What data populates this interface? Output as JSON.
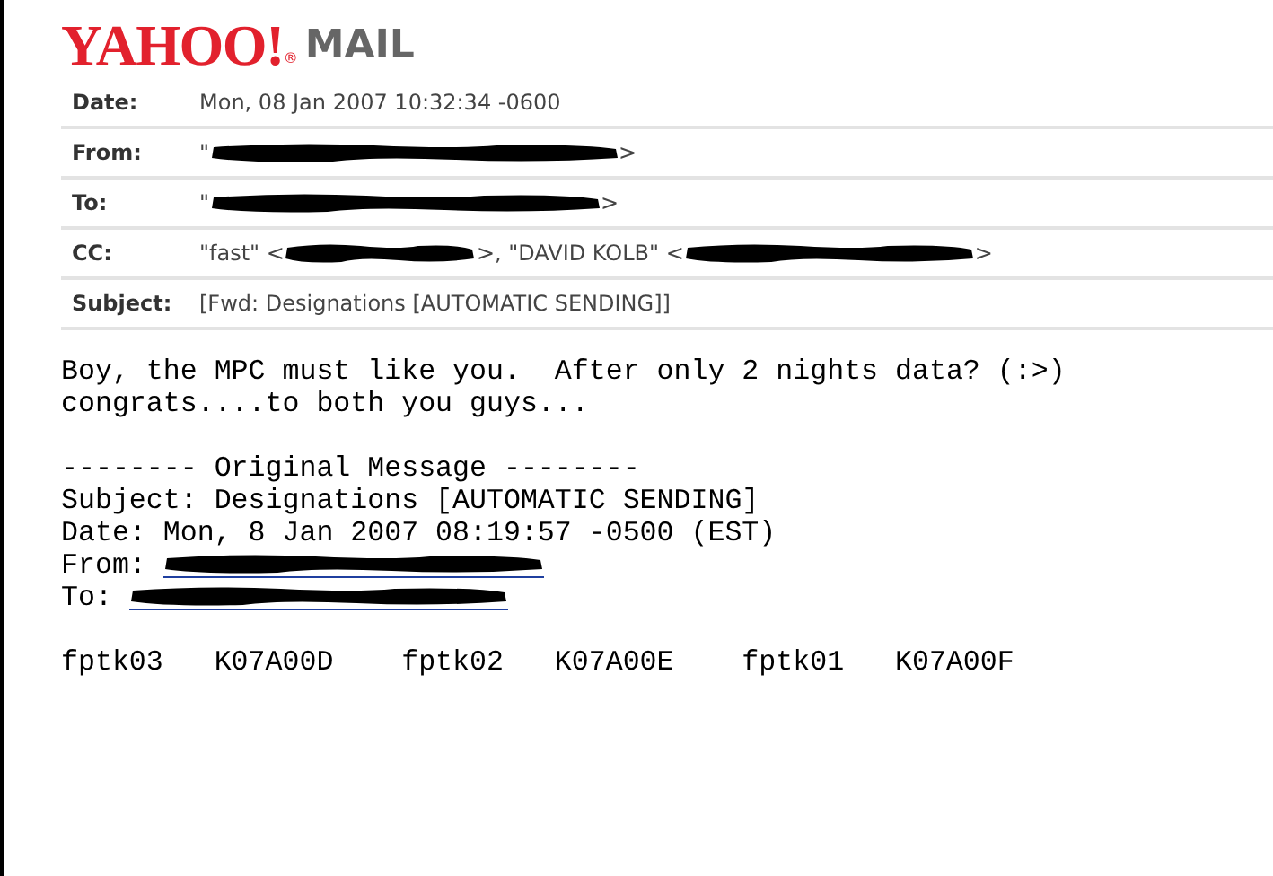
{
  "logo": {
    "brand": "YAHOO!",
    "registered": "®",
    "product": "MAIL"
  },
  "headers": [
    {
      "label": "Date:",
      "value": [
        {
          "kind": "text",
          "text": "Mon, 08 Jan 2007 10:32:34 -0600"
        }
      ]
    },
    {
      "label": "From:",
      "value": [
        {
          "kind": "text",
          "text": "\""
        },
        {
          "kind": "redaction"
        },
        {
          "kind": "text",
          "text": ">"
        }
      ]
    },
    {
      "label": "To:",
      "value": [
        {
          "kind": "text",
          "text": "\""
        },
        {
          "kind": "redaction"
        },
        {
          "kind": "text",
          "text": ">"
        }
      ]
    },
    {
      "label": "CC:",
      "value": [
        {
          "kind": "text",
          "text": "\"fast\" <"
        },
        {
          "kind": "redaction"
        },
        {
          "kind": "text",
          "text": ">, \"DAVID KOLB\" <"
        },
        {
          "kind": "redaction"
        },
        {
          "kind": "text",
          "text": ">"
        }
      ]
    },
    {
      "label": "Subject:",
      "value": [
        {
          "kind": "text",
          "text": "[Fwd: Designations [AUTOMATIC SENDING]]"
        }
      ]
    }
  ],
  "body": [
    [
      {
        "kind": "text",
        "text": "Boy, the MPC must like you.  After only 2 nights data? (:>)"
      },
      {
        "kind": "text",
        "text": "congrats....to both you guys..."
      }
    ],
    [
      {
        "kind": "text",
        "text": "-------- Original Message --------"
      },
      {
        "kind": "text",
        "text": "Subject: Designations [AUTOMATIC SENDING]"
      },
      {
        "kind": "text",
        "text": "Date: Mon, 8 Jan 2007 08:19:57 -0500 (EST)"
      },
      {
        "kind": "link",
        "text": "From: "
      },
      {
        "kind": "link",
        "text": "To: "
      }
    ],
    [
      {
        "kind": "text",
        "text": "fptk03   K07A00D    fptk02   K07A00E    fptk01   K07A00F"
      }
    ]
  ]
}
